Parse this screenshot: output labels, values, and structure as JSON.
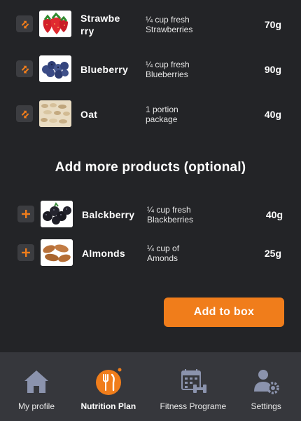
{
  "selected_products": [
    {
      "name_line1": "Strawbe",
      "name_line2": "rry",
      "desc_line1": "¼ cup fresh",
      "desc_line2": "Strawberries",
      "qty": "70g",
      "thumb_icon": "strawberry-image"
    },
    {
      "name_line1": "Blueberry",
      "name_line2": "",
      "desc_line1": "¼ cup fresh",
      "desc_line2": "Blueberries",
      "qty": "90g",
      "thumb_icon": "blueberry-image"
    },
    {
      "name_line1": "Oat",
      "name_line2": "",
      "desc_line1": "1 portion",
      "desc_line2": "package",
      "qty": "40g",
      "thumb_icon": "oat-image"
    }
  ],
  "optional_section": {
    "title": "Add more products (optional)",
    "items": [
      {
        "name": "Balckberry",
        "desc_line1": "¼ cup fresh",
        "desc_line2": "Blackberries",
        "qty": "40g",
        "thumb_icon": "blackberry-image"
      },
      {
        "name": "Almonds",
        "desc_line1": "¼ cup of",
        "desc_line2": "Amonds",
        "qty": "25g",
        "thumb_icon": "almond-image"
      }
    ]
  },
  "cta": {
    "label": "Add to box"
  },
  "bottom_nav": {
    "items": [
      {
        "label": "My profile",
        "icon": "home-icon",
        "active": false
      },
      {
        "label": "Nutrition Plan",
        "icon": "utensils-icon",
        "active": true
      },
      {
        "label": "Fitness Programe",
        "icon": "calendar-dumbbell-icon",
        "active": false
      },
      {
        "label": "Settings",
        "icon": "user-gear-icon",
        "active": false
      }
    ]
  },
  "colors": {
    "background": "#232427",
    "accent": "#f07d1b",
    "nav_background": "#36373c",
    "button_background": "#3c3d41"
  }
}
